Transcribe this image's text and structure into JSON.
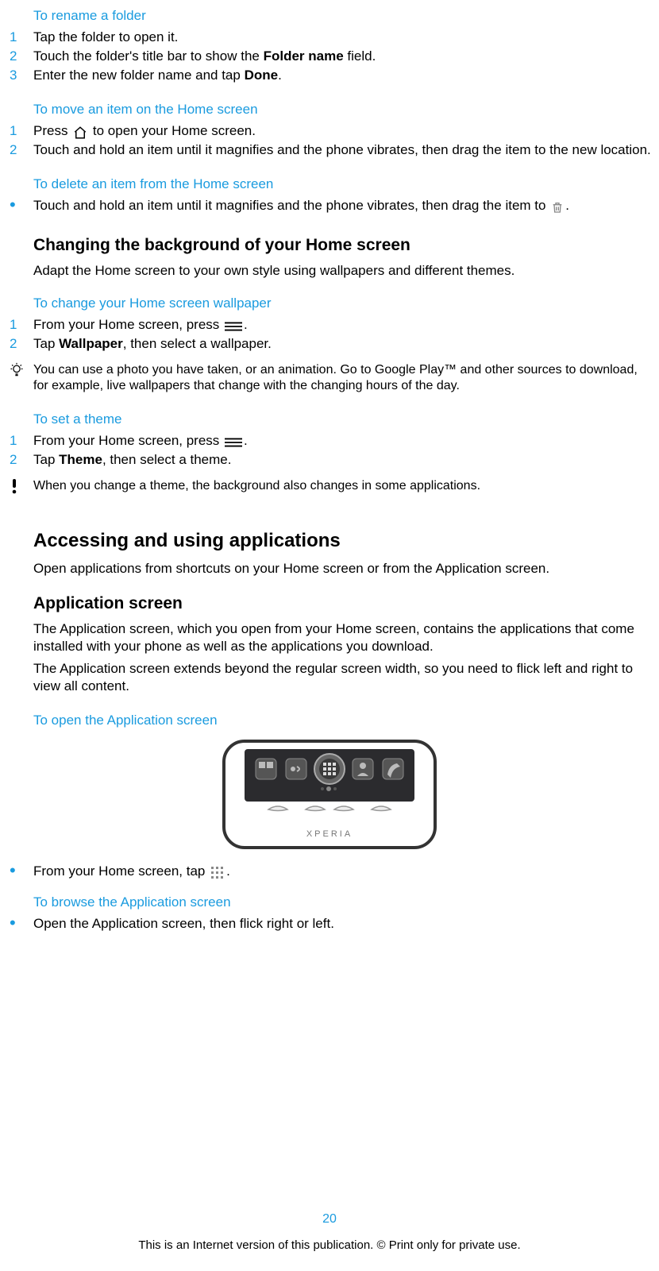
{
  "s1": {
    "title": "To rename a folder",
    "items": [
      {
        "n": "1",
        "t": "Tap the folder to open it."
      },
      {
        "n": "2",
        "pre": "Touch the folder's title bar to show the ",
        "b": "Folder name",
        "post": " field."
      },
      {
        "n": "3",
        "pre": "Enter the new folder name and tap ",
        "b": "Done",
        "post": "."
      }
    ]
  },
  "s2": {
    "title": "To move an item on the Home screen",
    "items": [
      {
        "n": "1",
        "pre": "Press ",
        "post": " to open your Home screen."
      },
      {
        "n": "2",
        "t": "Touch and hold an item until it magnifies and the phone vibrates, then drag the item to the new location."
      }
    ]
  },
  "s3": {
    "title": "To delete an item from the Home screen",
    "bullet": {
      "pre": "Touch and hold an item until it magnifies and the phone vibrates, then drag the item to ",
      "post": "."
    }
  },
  "h_change_bg": "Changing the background of your Home screen",
  "p_change_bg": "Adapt the Home screen to your own style using wallpapers and different themes.",
  "s4": {
    "title": "To change your Home screen wallpaper",
    "items": [
      {
        "n": "1",
        "pre": "From your Home screen, press ",
        "post": "."
      },
      {
        "n": "2",
        "pre": "Tap ",
        "b": "Wallpaper",
        "post": ", then select a wallpaper."
      }
    ],
    "tip": "You can use a photo you have taken, or an animation. Go to Google Play™ and other sources to download, for example, live wallpapers that change with the changing hours of the day."
  },
  "s5": {
    "title": "To set a theme",
    "items": [
      {
        "n": "1",
        "pre": "From your Home screen, press ",
        "post": "."
      },
      {
        "n": "2",
        "pre": "Tap ",
        "b": "Theme",
        "post": ", then select a theme."
      }
    ],
    "warn": "When you change a theme, the background also changes in some applications."
  },
  "h_access": "Accessing and using applications",
  "p_access": "Open applications from shortcuts on your Home screen or from the Application screen.",
  "h_appscr": "Application screen",
  "p_appscr1": "The Application screen, which you open from your Home screen, contains the applications that come installed with your phone as well as the applications you download.",
  "p_appscr2": "The Application screen extends beyond the regular screen width, so you need to flick left and right to view all content.",
  "s6": {
    "title": "To open the Application screen",
    "bullet": {
      "pre": "From your Home screen, tap ",
      "post": "."
    }
  },
  "s7": {
    "title": "To browse the Application screen",
    "bullet": {
      "t": "Open the Application screen, then flick right or left."
    }
  },
  "page_number": "20",
  "footer": "This is an Internet version of this publication. © Print only for private use."
}
